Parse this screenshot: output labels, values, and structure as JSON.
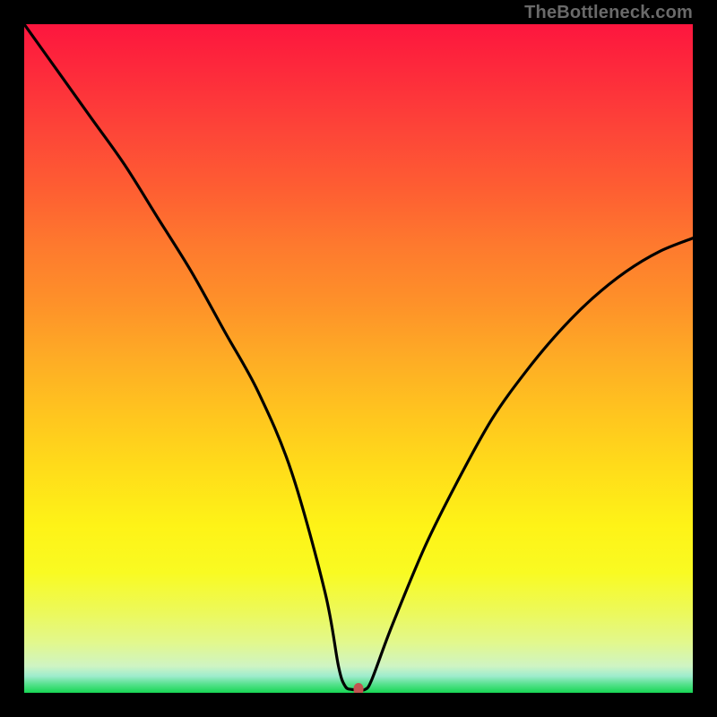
{
  "watermark": "TheBottleneck.com",
  "chart_data": {
    "type": "line",
    "title": "",
    "xlabel": "",
    "ylabel": "",
    "xlim": [
      0,
      100
    ],
    "ylim": [
      0,
      100
    ],
    "grid": false,
    "series": [
      {
        "name": "bottleneck-curve",
        "x": [
          0,
          5,
          10,
          15,
          20,
          25,
          30,
          35,
          40,
          45,
          47,
          48,
          49,
          50,
          51,
          52,
          55,
          60,
          65,
          70,
          75,
          80,
          85,
          90,
          95,
          100
        ],
        "values": [
          100,
          93,
          86,
          79,
          71,
          63,
          54,
          45,
          33,
          15,
          4,
          1,
          0.5,
          0.5,
          0.5,
          2,
          10,
          22,
          32,
          41,
          48,
          54,
          59,
          63,
          66,
          68
        ]
      }
    ],
    "marker": {
      "x": 50,
      "y": 0.5,
      "color": "#c25450"
    },
    "gradient": {
      "top_color": "#fd163e",
      "mid_color": "#ffdb1a",
      "bottom_color": "#17d754"
    }
  }
}
